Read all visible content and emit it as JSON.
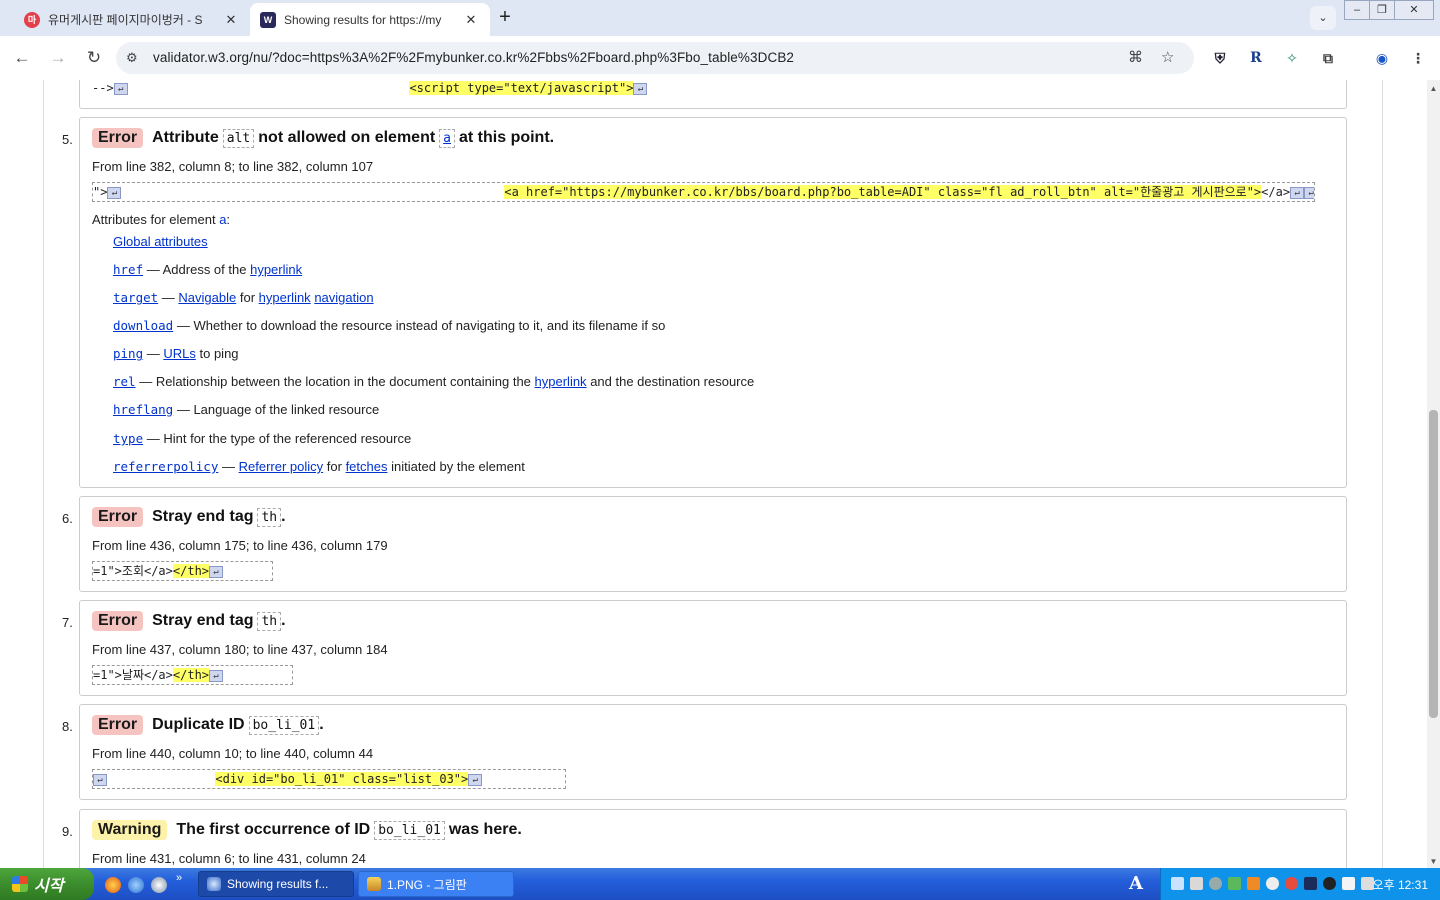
{
  "tabs": [
    {
      "title": "유머게시판 페이지마이벙커 - S",
      "active": false,
      "favicon": "mybunker-favicon"
    },
    {
      "title": "Showing results for https://my",
      "active": true,
      "favicon": "w3c-validator-favicon"
    }
  ],
  "address": {
    "url": "validator.w3.org/nu/?doc=https%3A%2F%2Fmybunker.co.kr%2Fbbs%2Fboard.php%3Fbo_table%3DCB2"
  },
  "top_fragment": {
    "left": "-->",
    "code": "<script type=\"text/javascript\">"
  },
  "messages": [
    {
      "n": "5.",
      "type": "Error",
      "head_pre": "Attribute",
      "code1": "alt",
      "head_mid": "not allowed on element",
      "code2": "a",
      "head_post": "at this point.",
      "location": "From line 382, column 8; to line 382, column 107",
      "extract_pre": "\">",
      "extract_hl": "<a href=\"https://mybunker.co.kr/bbs/board.php?bo_table=ADI\" class=\"fl ad_roll_btn\" alt=\"한줄광고 게시판으로\">",
      "extract_post": "</a>",
      "attrs_label": "Attributes for element",
      "attrs_elem": "a",
      "attrs_suffix": ":",
      "attributes": [
        {
          "name": "Global attributes",
          "desc": ""
        },
        {
          "name": "href",
          "desc": "— Address of the",
          "link": "hyperlink"
        },
        {
          "name": "target",
          "desc": "—",
          "link": "Navigable",
          "desc2": "for",
          "link2": "hyperlink",
          "link3": "navigation"
        },
        {
          "name": "download",
          "desc": "— Whether to download the resource instead of navigating to it, and its filename if so"
        },
        {
          "name": "ping",
          "desc": "—",
          "link": "URLs",
          "desc2": "to ping"
        },
        {
          "name": "rel",
          "desc": "— Relationship between the location in the document containing the",
          "link": "hyperlink",
          "desc2": "and the destination resource"
        },
        {
          "name": "hreflang",
          "desc": "— Language of the linked resource"
        },
        {
          "name": "type",
          "desc": "— Hint for the type of the referenced resource"
        },
        {
          "name": "referrerpolicy",
          "desc": "—",
          "link": "Referrer policy",
          "desc2": "for",
          "link2": "fetches",
          "desc3": "initiated by the element"
        }
      ]
    },
    {
      "n": "6.",
      "type": "Error",
      "head_pre": "Stray end tag",
      "code1": "th",
      "head_post": ".",
      "location": "From line 436, column 175; to line 436, column 179",
      "extract_pre": "=1\">조회</a>",
      "extract_hl": "</th>"
    },
    {
      "n": "7.",
      "type": "Error",
      "head_pre": "Stray end tag",
      "code1": "th",
      "head_post": ".",
      "location": "From line 437, column 180; to line 437, column 184",
      "extract_pre": "=1\">날짜</a>",
      "extract_hl": "</th>"
    },
    {
      "n": "8.",
      "type": "Error",
      "head_pre": "Duplicate ID",
      "code1": "bo_li_01",
      "head_post": ".",
      "location": "From line 440, column 10; to line 440, column 44",
      "extract_pre": "",
      "extract_hl": "<div id=\"bo_li_01\" class=\"list_03\">"
    },
    {
      "n": "9.",
      "type": "Warning",
      "head_pre": "The first occurrence of ID",
      "code1": "bo_li_01",
      "head_post": "was here.",
      "location": "From line 431, column 6; to line 431, column 24"
    }
  ],
  "taskbar": {
    "start": "시작",
    "windows": [
      {
        "label": "Showing results f...",
        "active": true
      },
      {
        "label": "1.PNG - 그림판",
        "active": false
      }
    ],
    "clock": "오후 12:31",
    "lang": "A"
  },
  "colors": {
    "error_badge": "#f6c4c0",
    "warning_badge": "#fdf2a9",
    "highlight": "#ffff66",
    "link": "#0033cc"
  }
}
